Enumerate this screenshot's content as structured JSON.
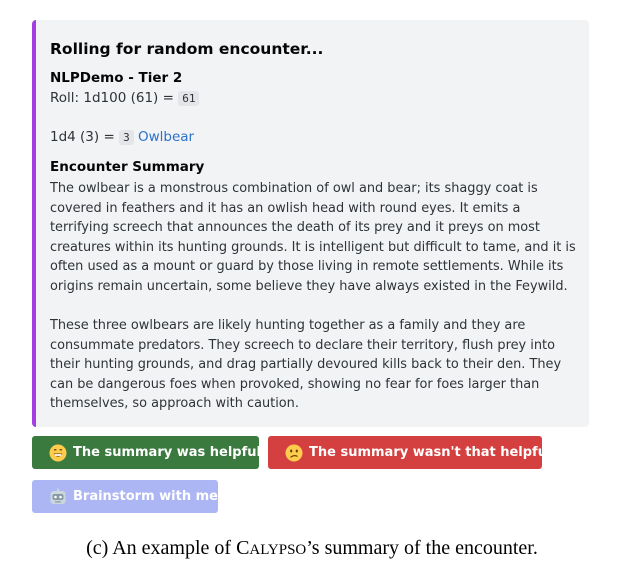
{
  "embed": {
    "accent_color": "#a43ee0",
    "title": "Rolling for random encounter...",
    "table_name": "NLPDemo - Tier 2",
    "roll": {
      "prefix": "Roll: 1d100 (61) = ",
      "result": "61"
    },
    "dice": {
      "prefix": "1d4 (3) = ",
      "result": "3",
      "monster_link": "Owlbear"
    },
    "summary_heading": "Encounter Summary",
    "paragraphs": [
      "The owlbear is a monstrous combination of owl and bear; its shaggy coat is covered in feathers and it has an owlish head with round eyes. It emits a terrifying screech that announces the death of its prey and it preys on most creatures within its hunting grounds. It is intelligent but difficult to tame, and it is often used as a mount or guard by those living in remote settlements. While its origins remain uncertain, some believe they have always existed in the Feywild.",
      "These three owlbears are likely hunting together as a family and they are consummate predators. They screech to declare their territory, flush prey into their hunting grounds, and drag partially devoured kills back to their den. They can be dangerous foes when provoked, showing no fear for foes larger than themselves, so approach with caution."
    ]
  },
  "buttons": {
    "helpful": {
      "label": "The summary was helpful!",
      "icon": "grinning-face-icon",
      "color": "#3b7a3f"
    },
    "not_helpful": {
      "label": "The summary wasn't that helpful.",
      "icon": "confused-face-icon",
      "color": "#d4403f"
    },
    "brainstorm": {
      "label": "Brainstorm with me",
      "icon": "robot-face-icon",
      "color": "#adb6f4"
    }
  },
  "caption": {
    "prefix": "(c) An example of ",
    "name_initial": "C",
    "name_rest": "ALYPSO",
    "suffix": "’s summary of the encounter."
  }
}
